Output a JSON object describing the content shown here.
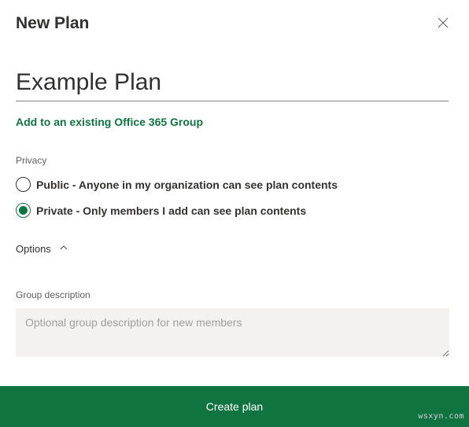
{
  "header": {
    "title": "New Plan"
  },
  "form": {
    "plan_name_value": "Example Plan",
    "add_group_link": "Add to an existing Office 365 Group",
    "privacy": {
      "label": "Privacy",
      "options": {
        "public": "Public - Anyone in my organization can see plan contents",
        "private": "Private - Only members I add can see plan contents"
      },
      "selected": "private"
    },
    "options_toggle": "Options",
    "group_description": {
      "label": "Group description",
      "placeholder": "Optional group description for new members",
      "value": ""
    }
  },
  "footer": {
    "create_label": "Create plan"
  },
  "watermark": "wsxyn.com"
}
